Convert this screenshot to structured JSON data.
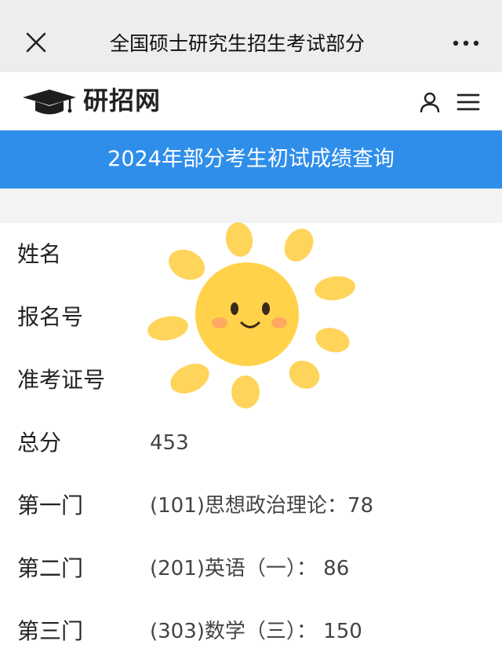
{
  "topbar": {
    "title": "全国硕士研究生招生考试部分"
  },
  "header": {
    "logo_text": "研招网"
  },
  "banner": {
    "text": "2024年部分考生初试成绩查询"
  },
  "rows": [
    {
      "label": "姓名",
      "value": ""
    },
    {
      "label": "报名号",
      "value": ""
    },
    {
      "label": "准考证号",
      "value": ""
    },
    {
      "label": "总分",
      "value": "453"
    },
    {
      "label": "第一门",
      "value": "(101)思想政治理论：78"
    },
    {
      "label": "第二门",
      "value": "(201)英语（一）： 86"
    },
    {
      "label": "第三门",
      "value": "(303)数学（三）： 150"
    }
  ],
  "icons": {
    "close": "close-icon",
    "more": "more-icon",
    "logo": "graduation-cap-icon",
    "user": "user-icon",
    "menu": "hamburger-menu-icon",
    "sticker": "sun-sticker"
  },
  "colors": {
    "topbar_bg": "#ededed",
    "banner_bg": "#2f8eea",
    "banner_text": "#ffffff",
    "sun_rays": "#ffd45a",
    "sun_face": "#ffd24a"
  }
}
